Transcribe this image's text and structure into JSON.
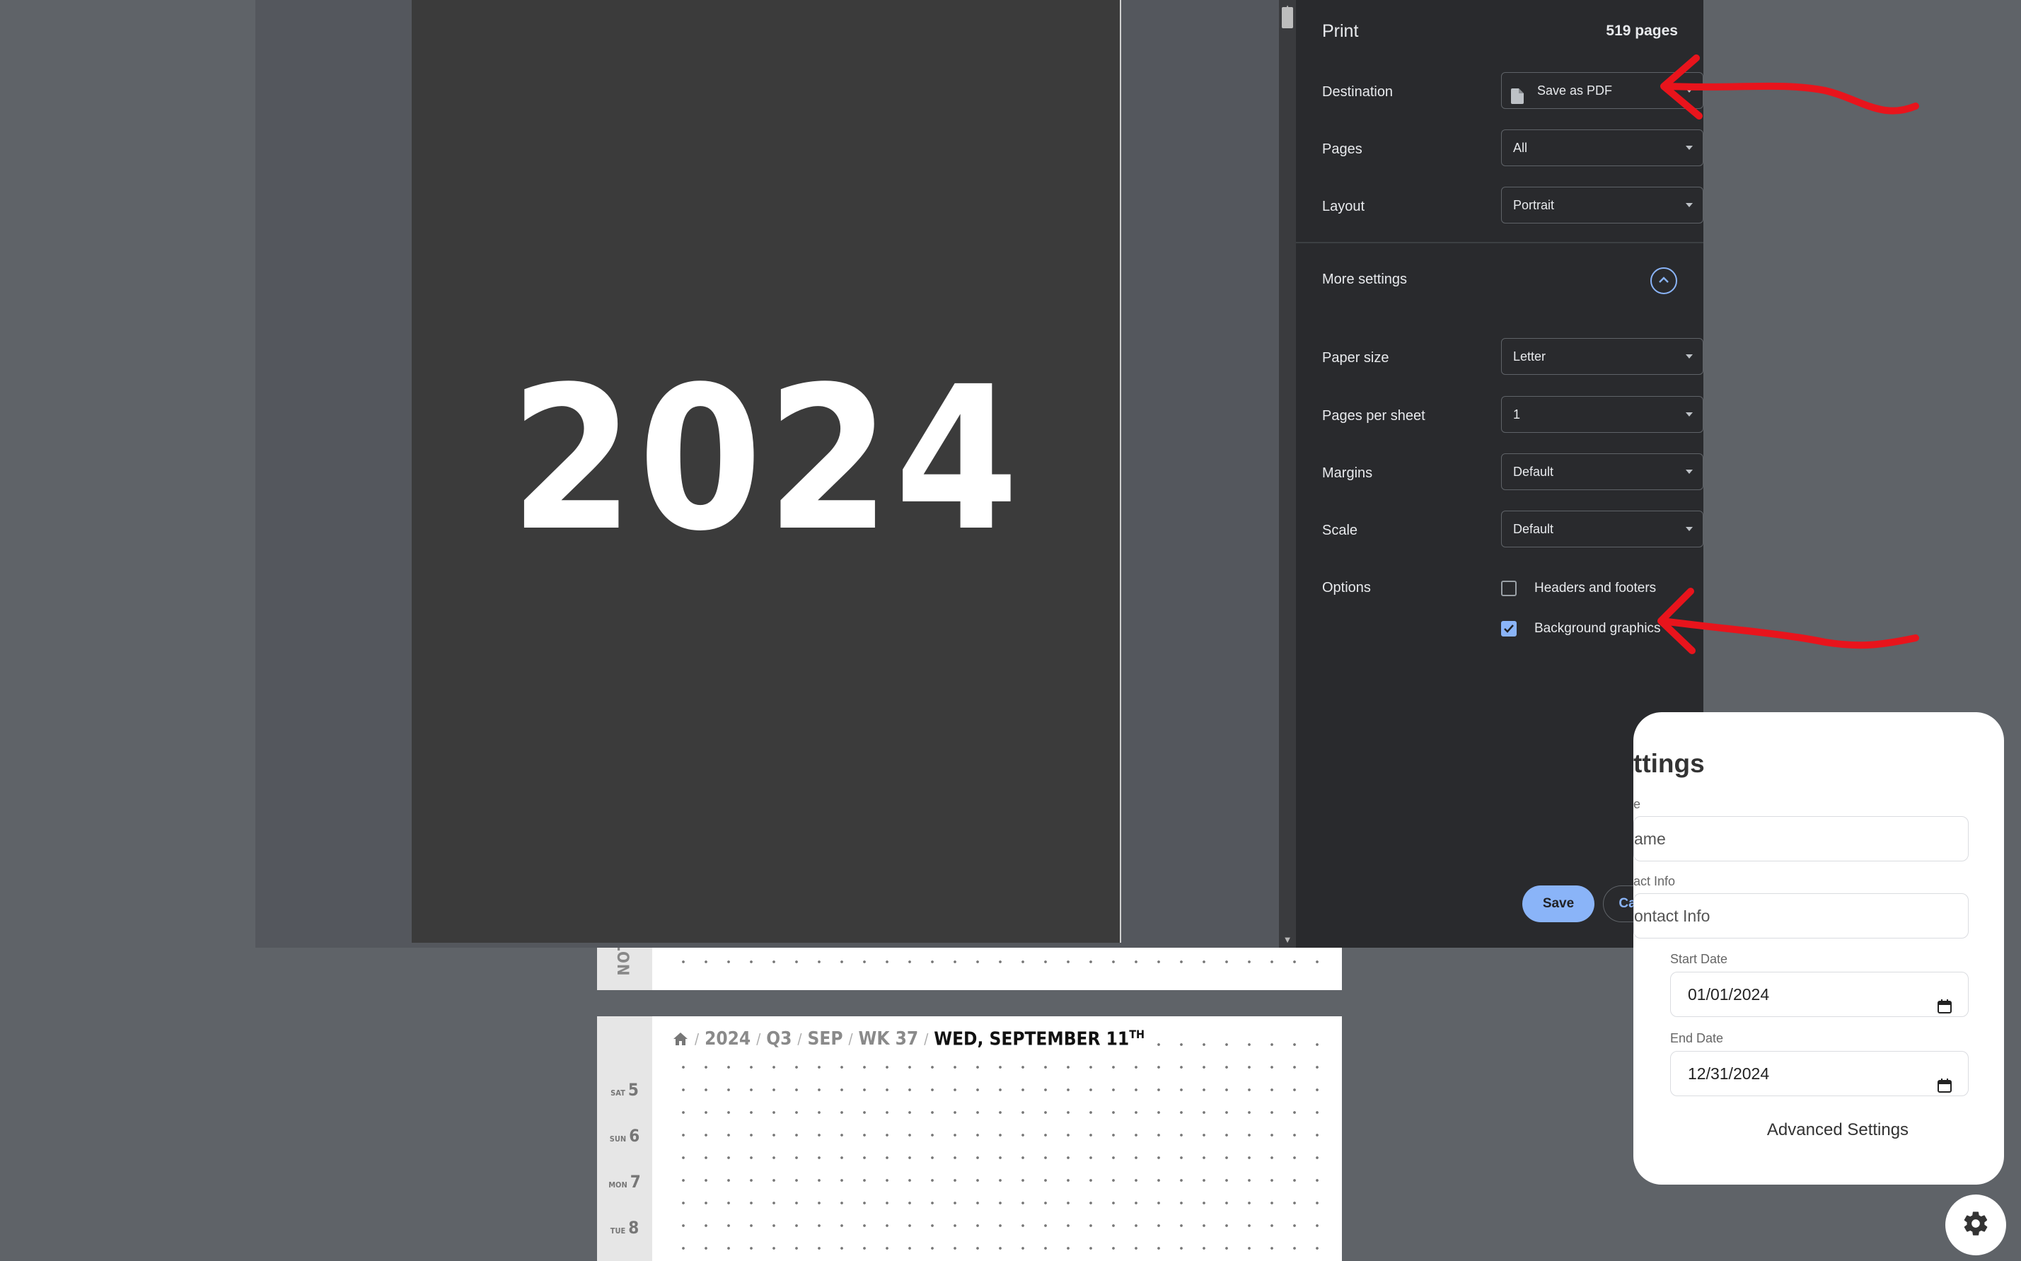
{
  "planner": {
    "notes_page": {
      "side_label": "NOTES"
    },
    "daily_page": {
      "breadcrumb": {
        "year": "2024",
        "quarter": "Q3",
        "month": "SEP",
        "week": "WK 37",
        "current_main": "WED, SEPTEMBER 11",
        "current_suffix": "TH",
        "separator": "/"
      },
      "days": [
        {
          "dow": "SAT",
          "num": "5"
        },
        {
          "dow": "SUN",
          "num": "6"
        },
        {
          "dow": "MON",
          "num": "7"
        },
        {
          "dow": "TUE",
          "num": "8"
        }
      ]
    }
  },
  "preview": {
    "cover_year": "2024"
  },
  "print_dialog": {
    "title": "Print",
    "page_count": "519 pages",
    "destination": {
      "label": "Destination",
      "value": "Save as PDF"
    },
    "pages": {
      "label": "Pages",
      "value": "All"
    },
    "layout": {
      "label": "Layout",
      "value": "Portrait"
    },
    "more_settings": "More settings",
    "paper_size": {
      "label": "Paper size",
      "value": "Letter"
    },
    "pages_per_sheet": {
      "label": "Pages per sheet",
      "value": "1"
    },
    "margins": {
      "label": "Margins",
      "value": "Default"
    },
    "scale": {
      "label": "Scale",
      "value": "Default"
    },
    "options": {
      "label": "Options",
      "headers_footers": {
        "label": "Headers and footers",
        "checked": false
      },
      "background_graphics": {
        "label": "Background graphics",
        "checked": true
      }
    },
    "save_label": "Save",
    "cancel_label": "Cancel",
    "accent_color": "#8ab4f8",
    "background_color": "#292a2d"
  },
  "settings_card": {
    "title_visible": "ttings",
    "name_label_visible": "e",
    "name_placeholder_visible": "ame",
    "contact_label_visible": "act Info",
    "contact_placeholder_visible": "ontact Info",
    "start_date_label": "Start Date",
    "start_date_value": "01/01/2024",
    "end_date_label": "End Date",
    "end_date_value": "12/31/2024",
    "advanced_settings": "Advanced Settings"
  },
  "annotation_color": "#e8141c"
}
